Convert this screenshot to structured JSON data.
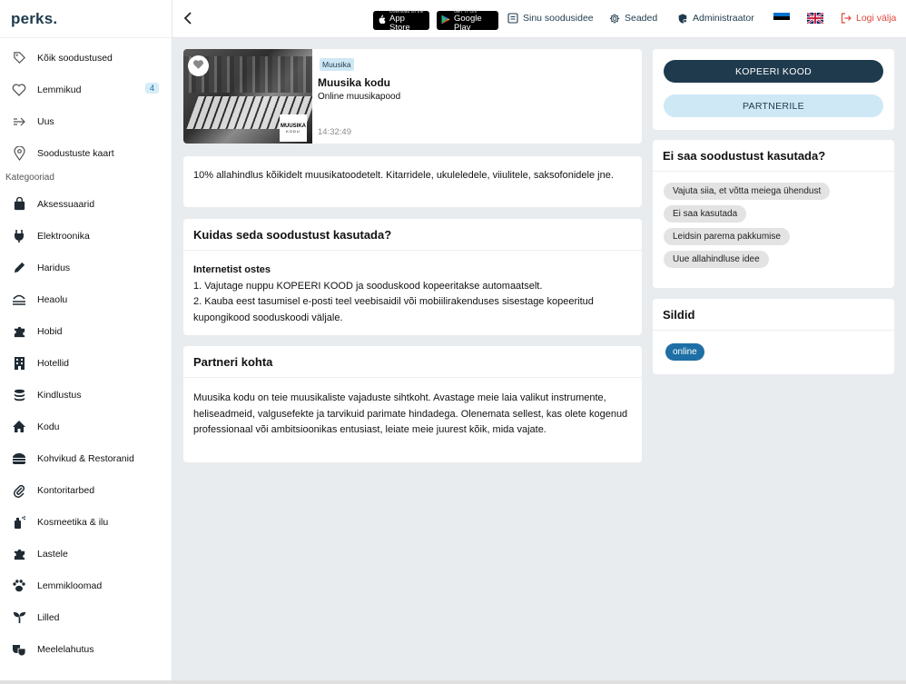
{
  "app": {
    "logo": "perks."
  },
  "sidebar": {
    "top_items": [
      {
        "label": "Kõik soodustused",
        "icon": "tag-icon"
      },
      {
        "label": "Lemmikud",
        "icon": "heart-icon",
        "badge": "4"
      },
      {
        "label": "Uus",
        "icon": "arrow-right-icon"
      },
      {
        "label": "Soodustuste kaart",
        "icon": "map-pin-icon"
      }
    ],
    "categories_heading": "Kategooriad",
    "categories": [
      {
        "label": "Aksessuaarid",
        "icon": "bag-icon"
      },
      {
        "label": "Elektroonika",
        "icon": "plug-icon"
      },
      {
        "label": "Haridus",
        "icon": "pencil-icon"
      },
      {
        "label": "Heaolu",
        "icon": "spa-icon"
      },
      {
        "label": "Hobid",
        "icon": "puzzle-icon"
      },
      {
        "label": "Hotellid",
        "icon": "building-icon"
      },
      {
        "label": "Kindlustus",
        "icon": "coins-icon"
      },
      {
        "label": "Kodu",
        "icon": "house-icon"
      },
      {
        "label": "Kohvikud & Restoranid",
        "icon": "burger-icon"
      },
      {
        "label": "Kontoritarbed",
        "icon": "paperclip-icon"
      },
      {
        "label": "Kosmeetika & ilu",
        "icon": "spray-icon"
      },
      {
        "label": "Lastele",
        "icon": "puzzle-icon"
      },
      {
        "label": "Lemmikloomad",
        "icon": "paw-icon"
      },
      {
        "label": "Lilled",
        "icon": "sprout-icon"
      },
      {
        "label": "Meelelahutus",
        "icon": "masks-icon"
      }
    ]
  },
  "topbar": {
    "app_store": {
      "small": "Download on the",
      "big": "App Store"
    },
    "google_play": {
      "small": "GET IT ON",
      "big": "Google Play"
    },
    "suggest": "Sinu soodusidee",
    "settings": "Seaded",
    "admin": "Administraator",
    "logout": "Logi välja"
  },
  "deal": {
    "category": "Muusika",
    "title": "Muusika kodu",
    "subtitle": "Online muusikapood",
    "time": "14:32:49",
    "logo_text_1": "MUUSIKA",
    "logo_text_2": "KODU",
    "description": "10% allahindlus kõikidelt muusikatoodetelt. Kitarridele, ukuleledele, viiulitele, saksofonidele jne.",
    "how_title": "Kuidas seda soodustust kasutada?",
    "how_subtitle": "Internetist ostes",
    "how_step1": "1. Vajutage nuppu KOPEERI KOOD ja sooduskood kopeeritakse automaatselt.",
    "how_step2": "2. Kauba eest tasumisel e-posti teel veebisaidil või mobiilirakenduses sisestage kopeeritud kupongikood sooduskoodi väljale.",
    "partner_title": "Partneri kohta",
    "partner_text": "Muusika kodu on teie muusikaliste vajaduste sihtkoht. Avastage meie laia valikut instrumente, heliseadmeid, valgusefekte ja tarvikuid parimate hindadega. Olenemata sellest, kas olete kogenud professionaal või ambitsioonikas entusiast, leiate meie juurest kõik, mida vajate."
  },
  "actions": {
    "copy_code": "KOPEERI KOOD",
    "to_partner": "PARTNERILE"
  },
  "issues": {
    "title": "Ei saa soodustust kasutada?",
    "options": [
      "Vajuta siia, et võtta meiega ühendust",
      "Ei saa kasutada",
      "Leidsin parema pakkumise",
      "Uue allahindluse idee"
    ]
  },
  "tags": {
    "title": "Sildid",
    "items": [
      "online"
    ]
  },
  "colors": {
    "brand": "#1f3a4d",
    "accent_light": "#cfe8f6",
    "tag": "#1d6fa5",
    "logout": "#e0473f"
  }
}
